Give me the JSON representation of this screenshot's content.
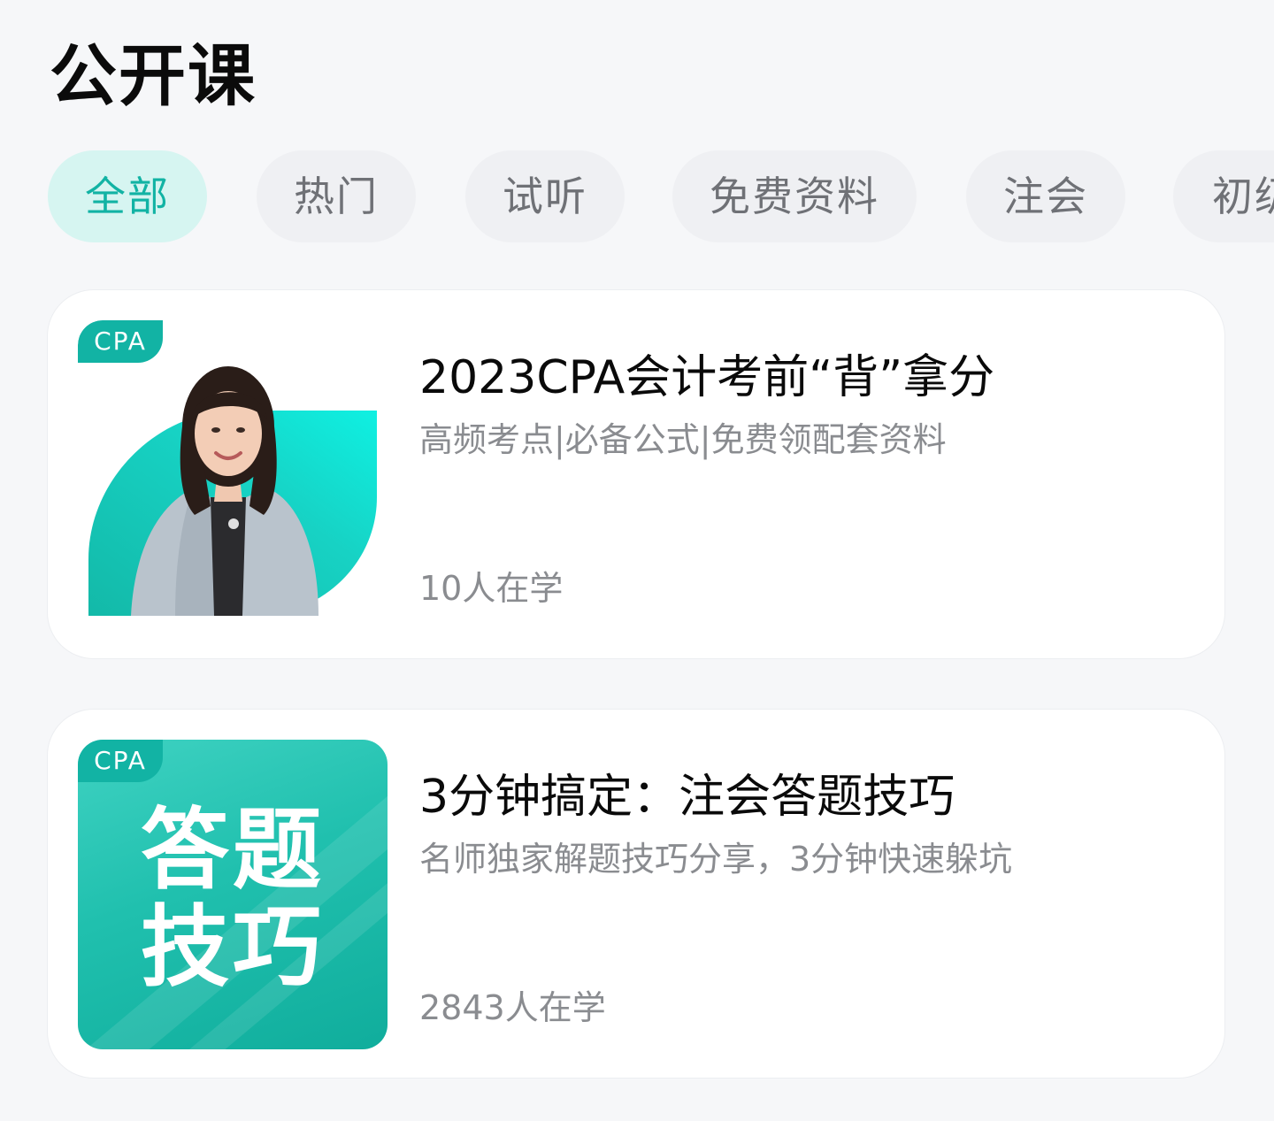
{
  "header": {
    "title": "公开课"
  },
  "tabs": [
    {
      "label": "全部",
      "active": true
    },
    {
      "label": "热门",
      "active": false
    },
    {
      "label": "试听",
      "active": false
    },
    {
      "label": "免费资料",
      "active": false
    },
    {
      "label": "注会",
      "active": false
    },
    {
      "label": "初级",
      "active": false
    }
  ],
  "courses": [
    {
      "tag": "CPA",
      "title": "2023CPA会计考前“背”拿分",
      "subtitle": "高频考点|必备公式|免费领配套资料",
      "learners": "10人在学"
    },
    {
      "tag": "CPA",
      "thumb_text_line1": "答题",
      "thumb_text_line2": "技巧",
      "title": "3分钟搞定：注会答题技巧",
      "subtitle": "名师独家解题技巧分享，3分钟快速躲坑",
      "learners": "2843人在学"
    }
  ],
  "colors": {
    "accent": "#12b3a4",
    "active_tab_bg": "#d6f5f1",
    "tab_bg": "#eff0f3",
    "page_bg": "#f6f7f9"
  }
}
